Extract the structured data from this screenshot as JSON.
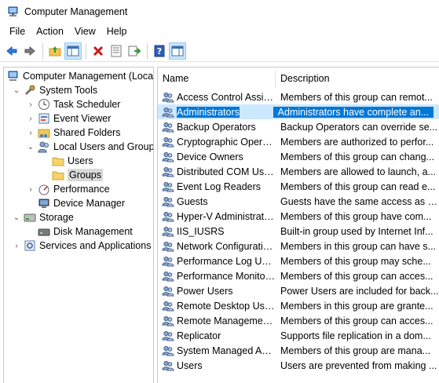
{
  "window": {
    "title": "Computer Management"
  },
  "menu": [
    "File",
    "Action",
    "View",
    "Help"
  ],
  "toolbar": {
    "buttons": [
      "back-icon",
      "forward-icon",
      "up-folder-icon",
      "show-hide-tree-icon",
      "delete-icon",
      "properties-icon",
      "export-icon",
      "help-icon",
      "show-hide-action-pane-icon"
    ]
  },
  "tree": {
    "items": [
      {
        "label": "Computer Management (Local",
        "icon": "computer-management-icon"
      },
      {
        "label": "System Tools",
        "icon": "tools-icon"
      },
      {
        "label": "Task Scheduler",
        "icon": "clock-icon"
      },
      {
        "label": "Event Viewer",
        "icon": "event-viewer-icon"
      },
      {
        "label": "Shared Folders",
        "icon": "shared-folder-icon"
      },
      {
        "label": "Local Users and Groups",
        "icon": "users-icon"
      },
      {
        "label": "Users",
        "icon": "folder-icon"
      },
      {
        "label": "Groups",
        "icon": "folder-icon"
      },
      {
        "label": "Performance",
        "icon": "performance-icon"
      },
      {
        "label": "Device Manager",
        "icon": "device-manager-icon"
      },
      {
        "label": "Storage",
        "icon": "storage-icon"
      },
      {
        "label": "Disk Management",
        "icon": "disk-icon"
      },
      {
        "label": "Services and Applications",
        "icon": "services-icon"
      }
    ]
  },
  "list": {
    "columns": {
      "name": "Name",
      "description": "Description"
    },
    "rows": [
      {
        "name": "Access Control Assist...",
        "description": "Members of this group can remot..."
      },
      {
        "name": "Administrators",
        "description": "Administrators have complete an..."
      },
      {
        "name": "Backup Operators",
        "description": "Backup Operators can override se..."
      },
      {
        "name": "Cryptographic Operat...",
        "description": "Members are authorized to perfor..."
      },
      {
        "name": "Device Owners",
        "description": "Members of this group can chang..."
      },
      {
        "name": "Distributed COM Users",
        "description": "Members are allowed to launch, a..."
      },
      {
        "name": "Event Log Readers",
        "description": "Members of this group can read e..."
      },
      {
        "name": "Guests",
        "description": "Guests have the same access as m..."
      },
      {
        "name": "Hyper-V Administrators",
        "description": "Members of this group have com..."
      },
      {
        "name": "IIS_IUSRS",
        "description": "Built-in group used by Internet Inf..."
      },
      {
        "name": "Network Configuratio...",
        "description": "Members in this group can have s..."
      },
      {
        "name": "Performance Log Users",
        "description": "Members of this group may sche..."
      },
      {
        "name": "Performance Monitor ...",
        "description": "Members of this group can acces..."
      },
      {
        "name": "Power Users",
        "description": "Power Users are included for back..."
      },
      {
        "name": "Remote Desktop Users",
        "description": "Members in this group are grante..."
      },
      {
        "name": "Remote Management...",
        "description": "Members of this group can acces..."
      },
      {
        "name": "Replicator",
        "description": "Supports file replication in a dom..."
      },
      {
        "name": "System Managed Acc...",
        "description": "Members of this group are mana..."
      },
      {
        "name": "Users",
        "description": "Users are prevented from making ..."
      }
    ],
    "selected_index": 1
  },
  "colors": {
    "selection": "#0078d7",
    "selection_row": "#cce8ff"
  }
}
